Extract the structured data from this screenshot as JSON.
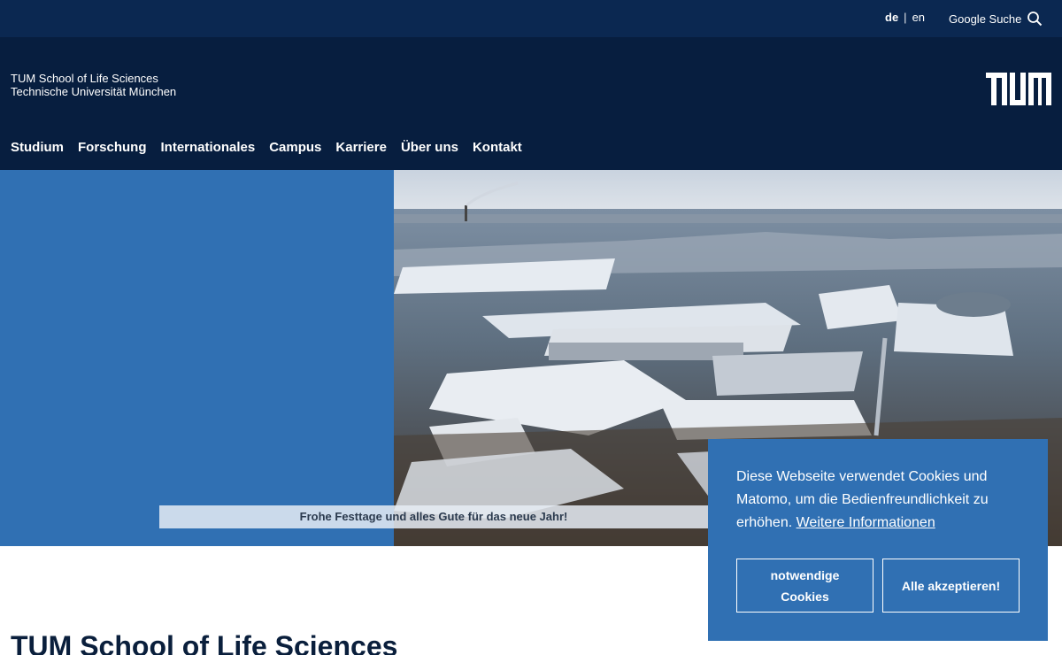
{
  "topbar": {
    "lang_de": "de",
    "lang_sep": "|",
    "lang_en": "en",
    "search_label": "Google Suche",
    "search_icon": "search-icon"
  },
  "header": {
    "line1": "TUM School of Life Sciences",
    "line2": "Technische Universität München",
    "logo_alt": "TUM",
    "nav": [
      "Studium",
      "Forschung",
      "Internationales",
      "Campus",
      "Karriere",
      "Über uns",
      "Kontakt"
    ]
  },
  "hero": {
    "caption": "Frohe Festtage und alles Gute für das neue Jahr!"
  },
  "main": {
    "title": "TUM School of Life Sciences"
  },
  "cookie": {
    "text": "Diese Webseite verwendet Cookies und Matomo, um die Bedienfreundlichkeit zu erhöhen.",
    "link": "Weitere Informationen",
    "btn_necessary_line1": "notwendige",
    "btn_necessary_line2": "Cookies",
    "btn_accept": "Alle akzeptieren!"
  },
  "colors": {
    "topbar": "#0b2851",
    "header": "#071e3f",
    "accent_blue": "#3070b3"
  }
}
